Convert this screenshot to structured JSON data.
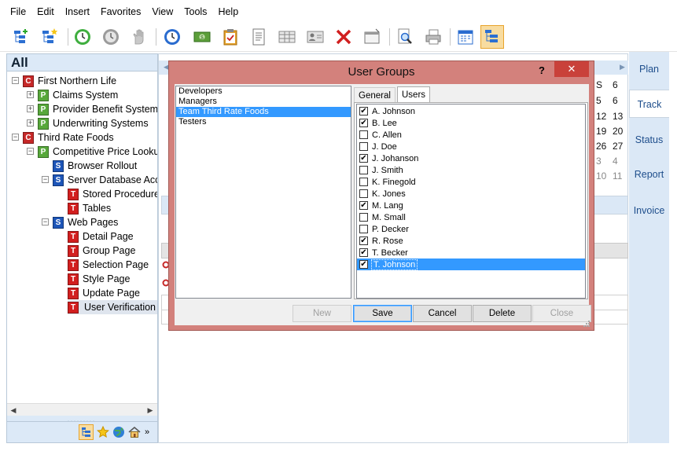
{
  "menu": [
    "File",
    "Edit",
    "Insert",
    "Favorites",
    "View",
    "Tools",
    "Help"
  ],
  "toolbar_icons": [
    "new-project-icon",
    "new-item-icon",
    "clock-green-icon",
    "clock-gray-icon",
    "hand-icon",
    "clock-blue-icon",
    "money-icon",
    "clipboard-icon",
    "document-icon",
    "table-icon",
    "contact-card-icon",
    "delete-x-icon",
    "window-icon",
    "preview-icon",
    "print-icon",
    "calendar-icon",
    "tree-view-icon"
  ],
  "left_panel": {
    "title": "All",
    "tree": [
      {
        "badge": "C",
        "label": "First Northern Life",
        "level": 0,
        "expander": "−"
      },
      {
        "badge": "P",
        "label": "Claims System",
        "level": 1,
        "expander": "+"
      },
      {
        "badge": "P",
        "label": "Provider Benefit System",
        "level": 1,
        "expander": "+"
      },
      {
        "badge": "P",
        "label": "Underwriting Systems",
        "level": 1,
        "expander": "+"
      },
      {
        "badge": "C",
        "label": "Third Rate Foods",
        "level": 0,
        "expander": "−"
      },
      {
        "badge": "P",
        "label": "Competitive Price Lookup",
        "level": 1,
        "expander": "−"
      },
      {
        "badge": "S",
        "label": "Browser Rollout",
        "level": 2,
        "expander": ""
      },
      {
        "badge": "S",
        "label": "Server Database Access",
        "level": 2,
        "expander": "−"
      },
      {
        "badge": "T",
        "label": "Stored Procedures",
        "level": 3,
        "expander": ""
      },
      {
        "badge": "T",
        "label": "Tables",
        "level": 3,
        "expander": ""
      },
      {
        "badge": "S",
        "label": "Web Pages",
        "level": 2,
        "expander": "−"
      },
      {
        "badge": "T",
        "label": "Detail Page",
        "level": 3,
        "expander": ""
      },
      {
        "badge": "T",
        "label": "Group Page",
        "level": 3,
        "expander": ""
      },
      {
        "badge": "T",
        "label": "Selection Page",
        "level": 3,
        "expander": ""
      },
      {
        "badge": "T",
        "label": "Style Page",
        "level": 3,
        "expander": ""
      },
      {
        "badge": "T",
        "label": "Update Page",
        "level": 3,
        "expander": ""
      },
      {
        "badge": "T",
        "label": "User Verification",
        "level": 3,
        "expander": "",
        "selected": true
      }
    ],
    "bottom_icons": [
      "tree-view-icon",
      "star-icon",
      "globe-icon",
      "home-icon",
      "more-icon"
    ]
  },
  "right_nav": [
    "Plan",
    "Track",
    "Status",
    "Report",
    "Invoice"
  ],
  "right_nav_active": "Track",
  "calendar_rows": [
    [
      "S",
      "6"
    ],
    [
      "5",
      "6"
    ],
    [
      "12",
      "13"
    ],
    [
      "19",
      "20"
    ],
    [
      "26",
      "27"
    ],
    [
      "3",
      "4"
    ],
    [
      "10",
      "11"
    ]
  ],
  "dialog": {
    "title": "User Groups",
    "help_label": "?",
    "close_label": "✕",
    "groups": [
      "Developers",
      "Managers",
      "Team Third Rate Foods",
      "Testers"
    ],
    "selected_group": "Team Third Rate Foods",
    "tabs": [
      "General",
      "Users"
    ],
    "active_tab": "Users",
    "users": [
      {
        "name": "A. Johnson",
        "checked": true
      },
      {
        "name": "B. Lee",
        "checked": true
      },
      {
        "name": "C. Allen",
        "checked": false
      },
      {
        "name": "J. Doe",
        "checked": false
      },
      {
        "name": "J. Johanson",
        "checked": true
      },
      {
        "name": "J. Smith",
        "checked": false
      },
      {
        "name": "K. Finegold",
        "checked": false
      },
      {
        "name": "K. Jones",
        "checked": false
      },
      {
        "name": "M. Lang",
        "checked": true
      },
      {
        "name": "M. Small",
        "checked": false
      },
      {
        "name": "P. Decker",
        "checked": false
      },
      {
        "name": "R. Rose",
        "checked": true
      },
      {
        "name": "T. Becker",
        "checked": true
      },
      {
        "name": "T. Johnson",
        "checked": true,
        "selected": true
      }
    ],
    "buttons": {
      "new": "New",
      "save": "Save",
      "cancel": "Cancel",
      "delete": "Delete",
      "close": "Close"
    }
  }
}
